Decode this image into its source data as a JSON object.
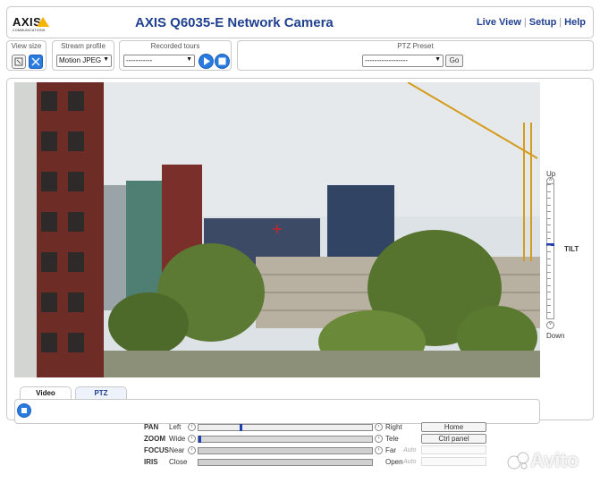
{
  "header": {
    "logo": "AXIS",
    "logo_sub": "COMMUNICATIONS",
    "title": "AXIS Q6035-E Network Camera",
    "links": [
      "Live View",
      "Setup",
      "Help"
    ],
    "separator": "|"
  },
  "toolbar": {
    "view_size_caption": "View size",
    "stream_profile_caption": "Stream profile",
    "stream_profile_value": "Motion JPEG",
    "recorded_tours_caption": "Recorded tours",
    "recorded_tours_value": "-----------",
    "ptz_preset_caption": "PTZ Preset",
    "ptz_preset_value": "------------------",
    "go_label": "Go"
  },
  "tilt": {
    "up": "Up",
    "down": "Down",
    "label": "TILT",
    "level": 0.45
  },
  "tabs": [
    "Video",
    "PTZ"
  ],
  "controls": {
    "pan": {
      "name": "PAN",
      "left": "Left",
      "right": "Right",
      "level": 0.24
    },
    "zoom": {
      "name": "ZOOM",
      "left": "Wide",
      "right": "Tele",
      "level": 0.0
    },
    "focus": {
      "name": "FOCUS",
      "left": "Near",
      "right": "Far",
      "auto": "Auto"
    },
    "iris": {
      "name": "IRIS",
      "left": "Close",
      "right": "Open",
      "auto": "Auto"
    },
    "home_label": "Home",
    "ctrl_panel_label": "Ctrl panel"
  },
  "watermark": "Avito",
  "colors": {
    "title_blue": "#1f3f8f",
    "accent_blue": "#2a7be0",
    "logo_yellow": "#f5b400"
  }
}
